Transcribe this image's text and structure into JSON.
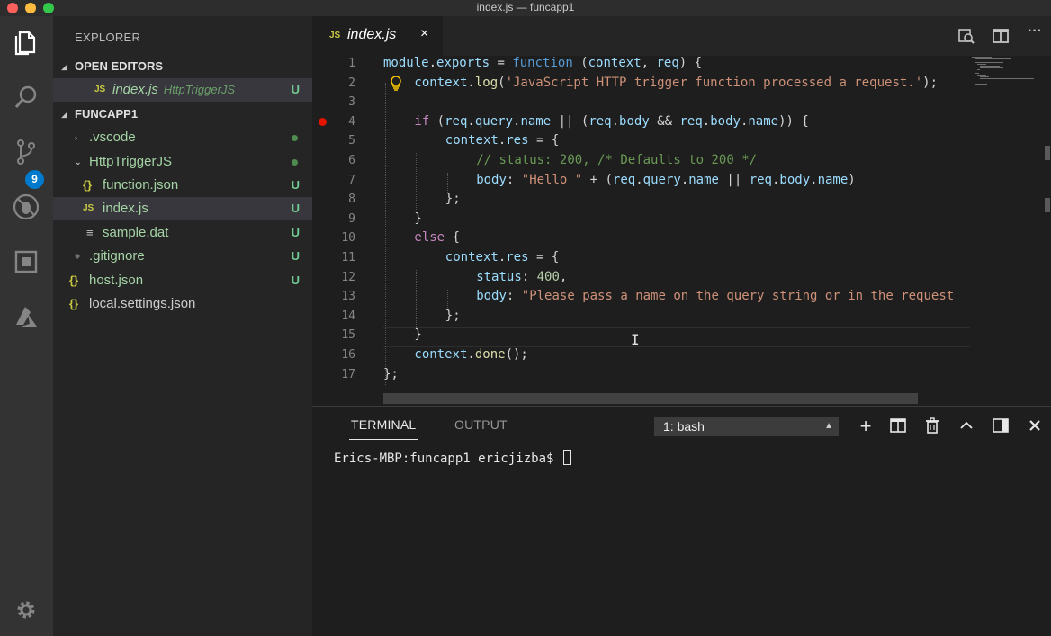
{
  "window": {
    "title": "index.js — funcapp1"
  },
  "activity_bar": {
    "items": [
      {
        "name": "explorer-icon"
      },
      {
        "name": "search-icon"
      },
      {
        "name": "source-control-icon",
        "badge": "9"
      },
      {
        "name": "debug-icon"
      },
      {
        "name": "extensions-icon"
      },
      {
        "name": "azure-icon"
      }
    ],
    "settings_icon": "gear-icon"
  },
  "sidebar": {
    "title": "EXPLORER",
    "open_editors": {
      "header": "OPEN EDITORS",
      "items": [
        {
          "icon": "JS",
          "label": "index.js",
          "description": "HttpTriggerJS",
          "status": "U"
        }
      ]
    },
    "project": {
      "header": "FUNCAPP1",
      "items": [
        {
          "icon": "›",
          "label": ".vscode",
          "status": "dot"
        },
        {
          "icon": "⌄",
          "label": "HttpTriggerJS",
          "status": "dot"
        },
        {
          "icon": "{}",
          "label": "function.json",
          "status": "U"
        },
        {
          "icon": "JS",
          "label": "index.js",
          "status": "U"
        },
        {
          "icon": "≡",
          "label": "sample.dat",
          "status": "U"
        },
        {
          "icon": "◆",
          "label": ".gitignore",
          "status": "U"
        },
        {
          "icon": "{}",
          "label": "host.json",
          "status": "U"
        },
        {
          "icon": "{}",
          "label": "local.settings.json",
          "status": ""
        }
      ]
    }
  },
  "editor": {
    "tab": {
      "icon": "JS",
      "label": "index.js",
      "close": "×"
    },
    "line_numbers": [
      "1",
      "2",
      "3",
      "4",
      "5",
      "6",
      "7",
      "8",
      "9",
      "10",
      "11",
      "12",
      "13",
      "14",
      "15",
      "16",
      "17"
    ],
    "breakpoint_line": 4,
    "code": {
      "l1": [
        "module",
        ".",
        "exports",
        " = ",
        "function",
        " (",
        "context",
        ", ",
        "req",
        ") {"
      ],
      "l2": [
        "context",
        ".",
        "log",
        "(",
        "'JavaScript HTTP trigger function processed a request.'",
        ");"
      ],
      "l4": [
        "if",
        " (",
        "req",
        ".",
        "query",
        ".",
        "name",
        " || (",
        "req",
        ".",
        "body",
        " && ",
        "req",
        ".",
        "body",
        ".",
        "name",
        ")) {"
      ],
      "l5": [
        "context",
        ".",
        "res",
        " = {"
      ],
      "l6": [
        "// status: 200, /* Defaults to 200 */"
      ],
      "l7": [
        "body",
        ": ",
        "\"Hello \"",
        " + (",
        "req",
        ".",
        "query",
        ".",
        "name",
        " || ",
        "req",
        ".",
        "body",
        ".",
        "name",
        ")"
      ],
      "l8": [
        "};"
      ],
      "l9": [
        "}"
      ],
      "l10": [
        "else",
        " {"
      ],
      "l11": [
        "context",
        ".",
        "res",
        " = {"
      ],
      "l12": [
        "status",
        ": ",
        "400",
        ","
      ],
      "l13": [
        "body",
        ": ",
        "\"Please pass a name on the query string or in the request"
      ],
      "l14": [
        "};"
      ],
      "l15": [
        "}"
      ],
      "l16": [
        "context",
        ".",
        "done",
        "();"
      ],
      "l17": [
        "};"
      ]
    }
  },
  "panel": {
    "tabs": [
      {
        "label": "TERMINAL",
        "active": true
      },
      {
        "label": "OUTPUT",
        "active": false
      }
    ],
    "terminal_select": "1: bash",
    "prompt": "Erics-MBP:funcapp1 ericjizba$ "
  },
  "colors": {
    "accent": "#007acc",
    "untracked_green": "#73c991",
    "breakpoint_red": "#e51400"
  }
}
